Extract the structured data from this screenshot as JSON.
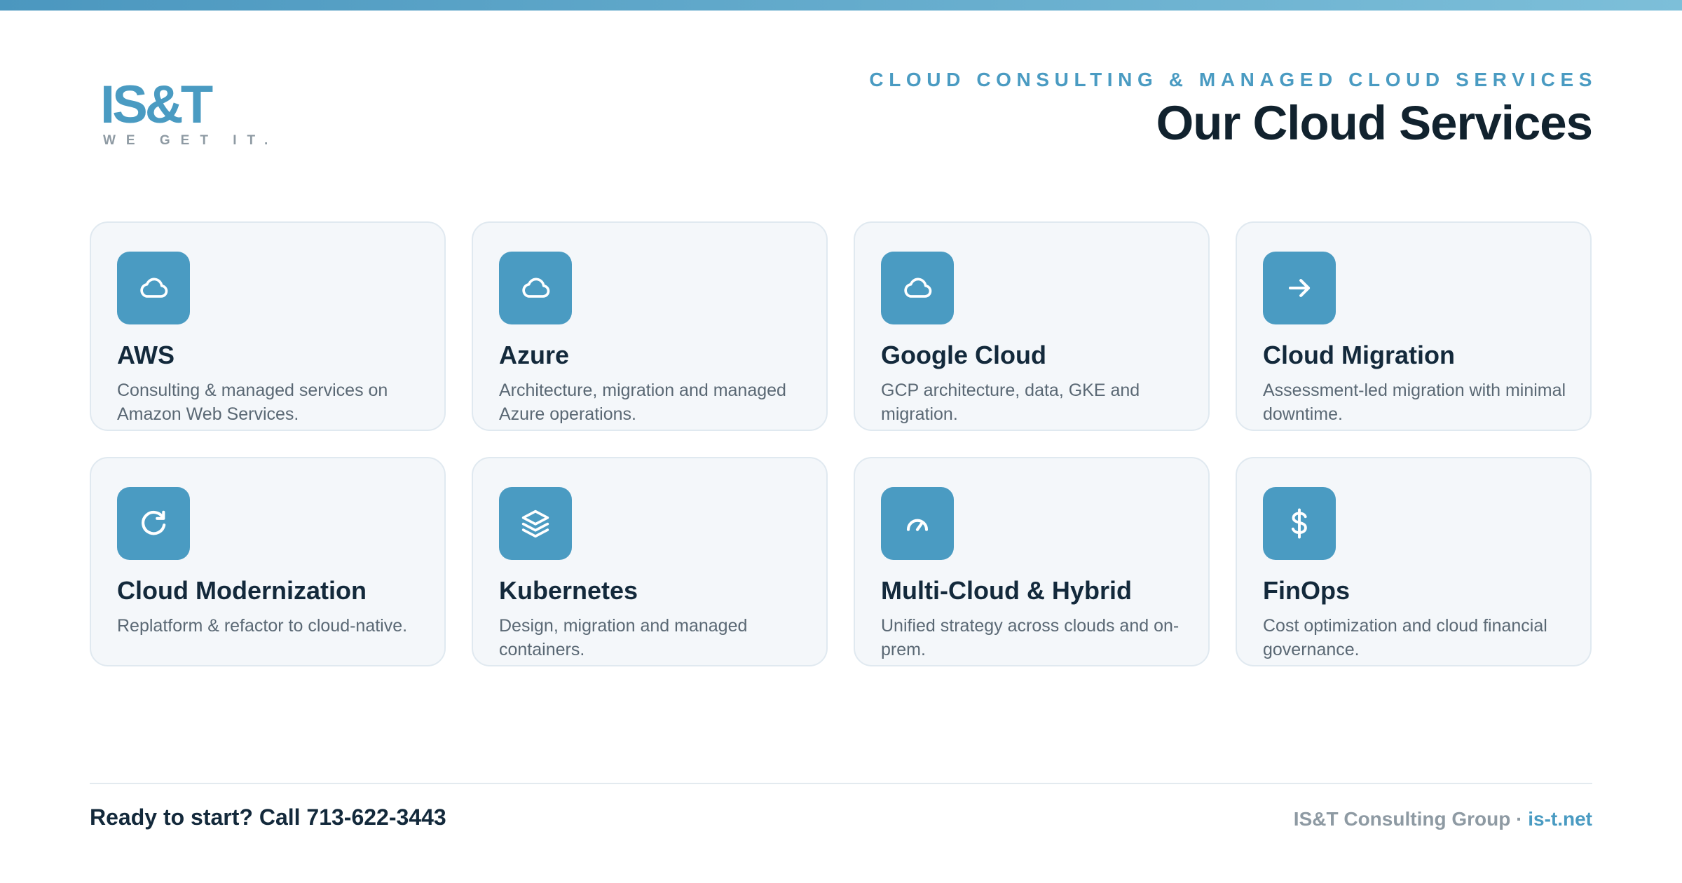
{
  "brand": {
    "logo_text": "IS&T",
    "tagline": "WE GET IT."
  },
  "header": {
    "eyebrow": "CLOUD CONSULTING & MANAGED CLOUD SERVICES",
    "title": "Our Cloud Services"
  },
  "colors": {
    "accent": "#4a9bc2",
    "heading": "#13293b",
    "card_bg": "#f4f7fa",
    "card_border": "#e0e9f0",
    "muted": "#8e9aa3"
  },
  "services": [
    {
      "icon": "cloud-icon",
      "title": "AWS",
      "description": "Consulting & managed services on Amazon Web Services."
    },
    {
      "icon": "cloud-icon",
      "title": "Azure",
      "description": "Architecture, migration and managed Azure operations."
    },
    {
      "icon": "cloud-icon",
      "title": "Google Cloud",
      "description": "GCP architecture, data, GKE and migration."
    },
    {
      "icon": "arrow-right-icon",
      "title": "Cloud Migration",
      "description": "Assessment-led migration with minimal downtime."
    },
    {
      "icon": "refresh-icon",
      "title": "Cloud Modernization",
      "description": "Replatform & refactor to cloud-native."
    },
    {
      "icon": "layers-icon",
      "title": "Kubernetes",
      "description": "Design, migration and managed containers."
    },
    {
      "icon": "gauge-icon",
      "title": "Multi-Cloud & Hybrid",
      "description": "Unified strategy across clouds and on-prem."
    },
    {
      "icon": "dollar-icon",
      "title": "FinOps",
      "description": "Cost optimization and cloud financial governance."
    }
  ],
  "footer": {
    "cta": "Ready to start? Call 713-622-3443",
    "company": "IS&T Consulting Group",
    "separator": " · ",
    "website": "is-t.net"
  }
}
